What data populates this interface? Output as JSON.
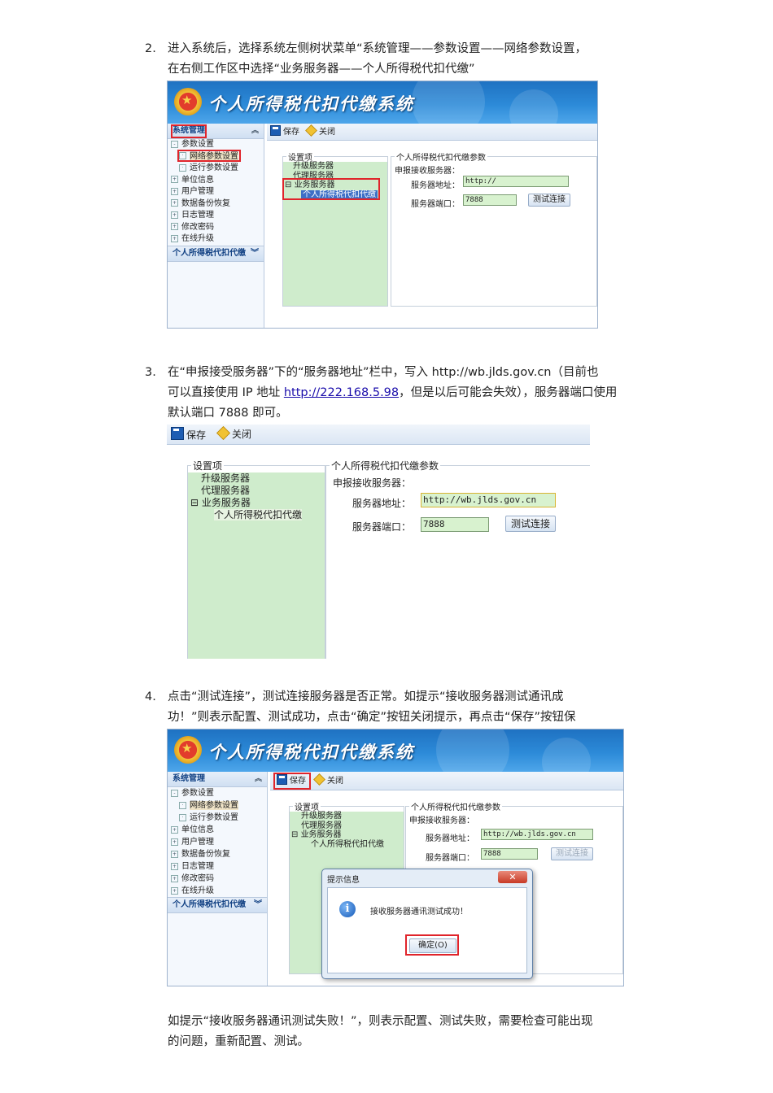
{
  "steps": [
    {
      "num": "2.",
      "line1": "进入系统后，选择系统左侧树状菜单“系统管理——参数设置——网络参数设置，",
      "line2": "在右侧工作区中选择“业务服务器——个人所得税代扣代缴”"
    },
    {
      "num": "3.",
      "line1": "在“申报接受服务器”下的“服务器地址”栏中，写入 http://wb.jlds.gov.cn（目前也",
      "line2a": "可以直接使用 IP 地址 ",
      "link": "http://222.168.5.98",
      "line2b": "，但是以后可能会失效），服务器端口使用",
      "line3": "默认端口 7888 即可。"
    },
    {
      "num": "4.",
      "line1": "点击“测试连接”，测试连接服务器是否正常。如提示“接收服务器测试通讯成",
      "line2": "功！”则表示配置、测试成功，点击“确定”按钮关闭提示，再点击“保存”按钮保"
    }
  ],
  "note": {
    "line1": "如提示“接收服务器通讯测试失败！”，则表示配置、测试失败，需要检查可能出现",
    "line2": "的问题，重新配置、测试。"
  },
  "app": {
    "title": "个人所得税代扣代缴系统",
    "sidebar_header": "系统管理",
    "sidebar_footer": "个人所得税代扣代缴",
    "menu": [
      "参数设置",
      "网络参数设置",
      "运行参数设置",
      "单位信息",
      "用户管理",
      "数据备份恢复",
      "日志管理",
      "修改密码",
      "在线升级"
    ],
    "toolbar": {
      "save": "保存",
      "close": "关闭"
    },
    "settings_legend": "设置项",
    "tree": [
      "升级服务器",
      "代理服务器",
      "业务服务器",
      "个人所得税代扣代缴"
    ],
    "params_legend": "个人所得税代扣代缴参数",
    "recv_label": "申报接收服务器：",
    "addr_label": "服务器地址：",
    "port_label": "服务器端口：",
    "addr_value_1": "http://",
    "addr_value_2": "http://wb.jlds.gov.cn",
    "port_value": "7888",
    "test_button": "测试连接",
    "dialog": {
      "title": "提示信息",
      "message": "接收服务器通讯测试成功！",
      "ok": "确定(O)",
      "close": "✕"
    }
  }
}
